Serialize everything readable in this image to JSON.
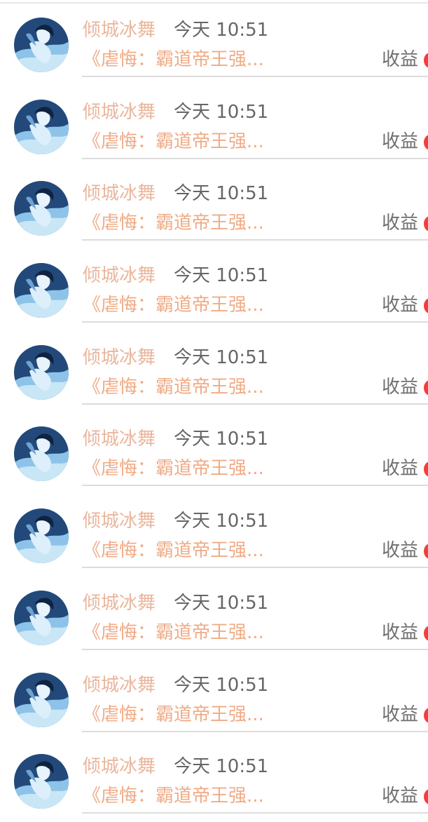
{
  "items": [
    {
      "author": "倾城冰舞",
      "time": "今天 10:51",
      "title": "《虐悔：霸道帝王强...",
      "earnings_label": "收益"
    },
    {
      "author": "倾城冰舞",
      "time": "今天 10:51",
      "title": "《虐悔：霸道帝王强...",
      "earnings_label": "收益"
    },
    {
      "author": "倾城冰舞",
      "time": "今天 10:51",
      "title": "《虐悔：霸道帝王强...",
      "earnings_label": "收益"
    },
    {
      "author": "倾城冰舞",
      "time": "今天 10:51",
      "title": "《虐悔：霸道帝王强...",
      "earnings_label": "收益"
    },
    {
      "author": "倾城冰舞",
      "time": "今天 10:51",
      "title": "《虐悔：霸道帝王强...",
      "earnings_label": "收益"
    },
    {
      "author": "倾城冰舞",
      "time": "今天 10:51",
      "title": "《虐悔：霸道帝王强...",
      "earnings_label": "收益"
    },
    {
      "author": "倾城冰舞",
      "time": "今天 10:51",
      "title": "《虐悔：霸道帝王强...",
      "earnings_label": "收益"
    },
    {
      "author": "倾城冰舞",
      "time": "今天 10:51",
      "title": "《虐悔：霸道帝王强...",
      "earnings_label": "收益"
    },
    {
      "author": "倾城冰舞",
      "time": "今天 10:51",
      "title": "《虐悔：霸道帝王强...",
      "earnings_label": "收益"
    },
    {
      "author": "倾城冰舞",
      "time": "今天 10:51",
      "title": "《虐悔：霸道帝王强...",
      "earnings_label": "收益"
    }
  ],
  "colors": {
    "author": "#eab69c",
    "time": "#666666",
    "title": "#f0ab86",
    "earnings_label": "#6f6f6f",
    "earnings_dot": "#f23e3e",
    "divider": "#dcdcdc"
  },
  "icons": {
    "avatar": "user-avatar-illustration"
  }
}
